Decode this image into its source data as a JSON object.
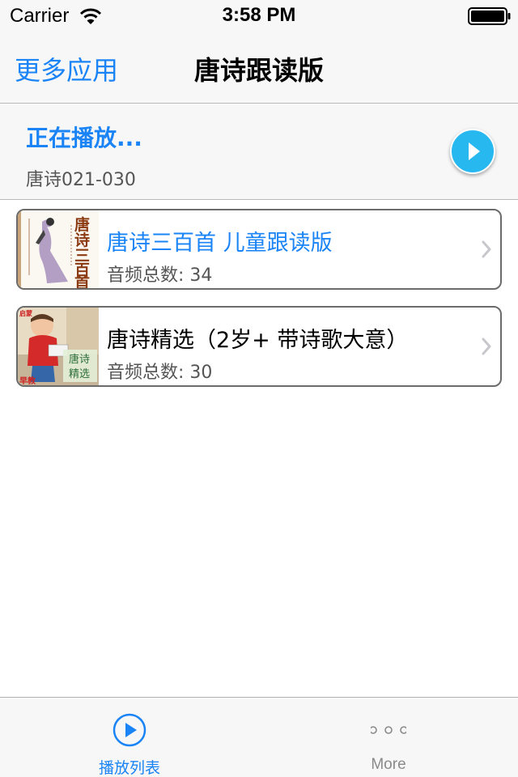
{
  "status_bar": {
    "carrier": "Carrier",
    "time": "3:58 PM",
    "icons": [
      "wifi-icon",
      "battery-icon"
    ]
  },
  "nav": {
    "left_button": "更多应用",
    "title": "唐诗跟读版"
  },
  "now_playing": {
    "label": "正在播放...",
    "track": "唐诗021-030",
    "play_icon": "play-icon"
  },
  "list": {
    "items": [
      {
        "title": "唐诗三百首 儿童跟读版",
        "meta": "音频总数: 34",
        "thumb_text": [
          "唐",
          "诗",
          "三",
          "百",
          "首"
        ],
        "icon": "chevron-right-icon"
      },
      {
        "title": "唐诗精选（2岁+ 带诗歌大意）",
        "meta": "音频总数: 30",
        "thumb_text": [
          "唐诗",
          "精选",
          "早教",
          "启蒙"
        ],
        "icon": "chevron-right-icon"
      }
    ]
  },
  "tab_bar": {
    "tabs": [
      {
        "label": "播放列表",
        "icon": "play-circle-icon",
        "active": true
      },
      {
        "label": "More",
        "icon": "more-dots-icon",
        "active": false
      }
    ]
  },
  "colors": {
    "accent": "#1a84f6",
    "play_button": "#27b8f0",
    "bar_background": "#f7f7f7",
    "inactive": "#8a8a8a"
  }
}
